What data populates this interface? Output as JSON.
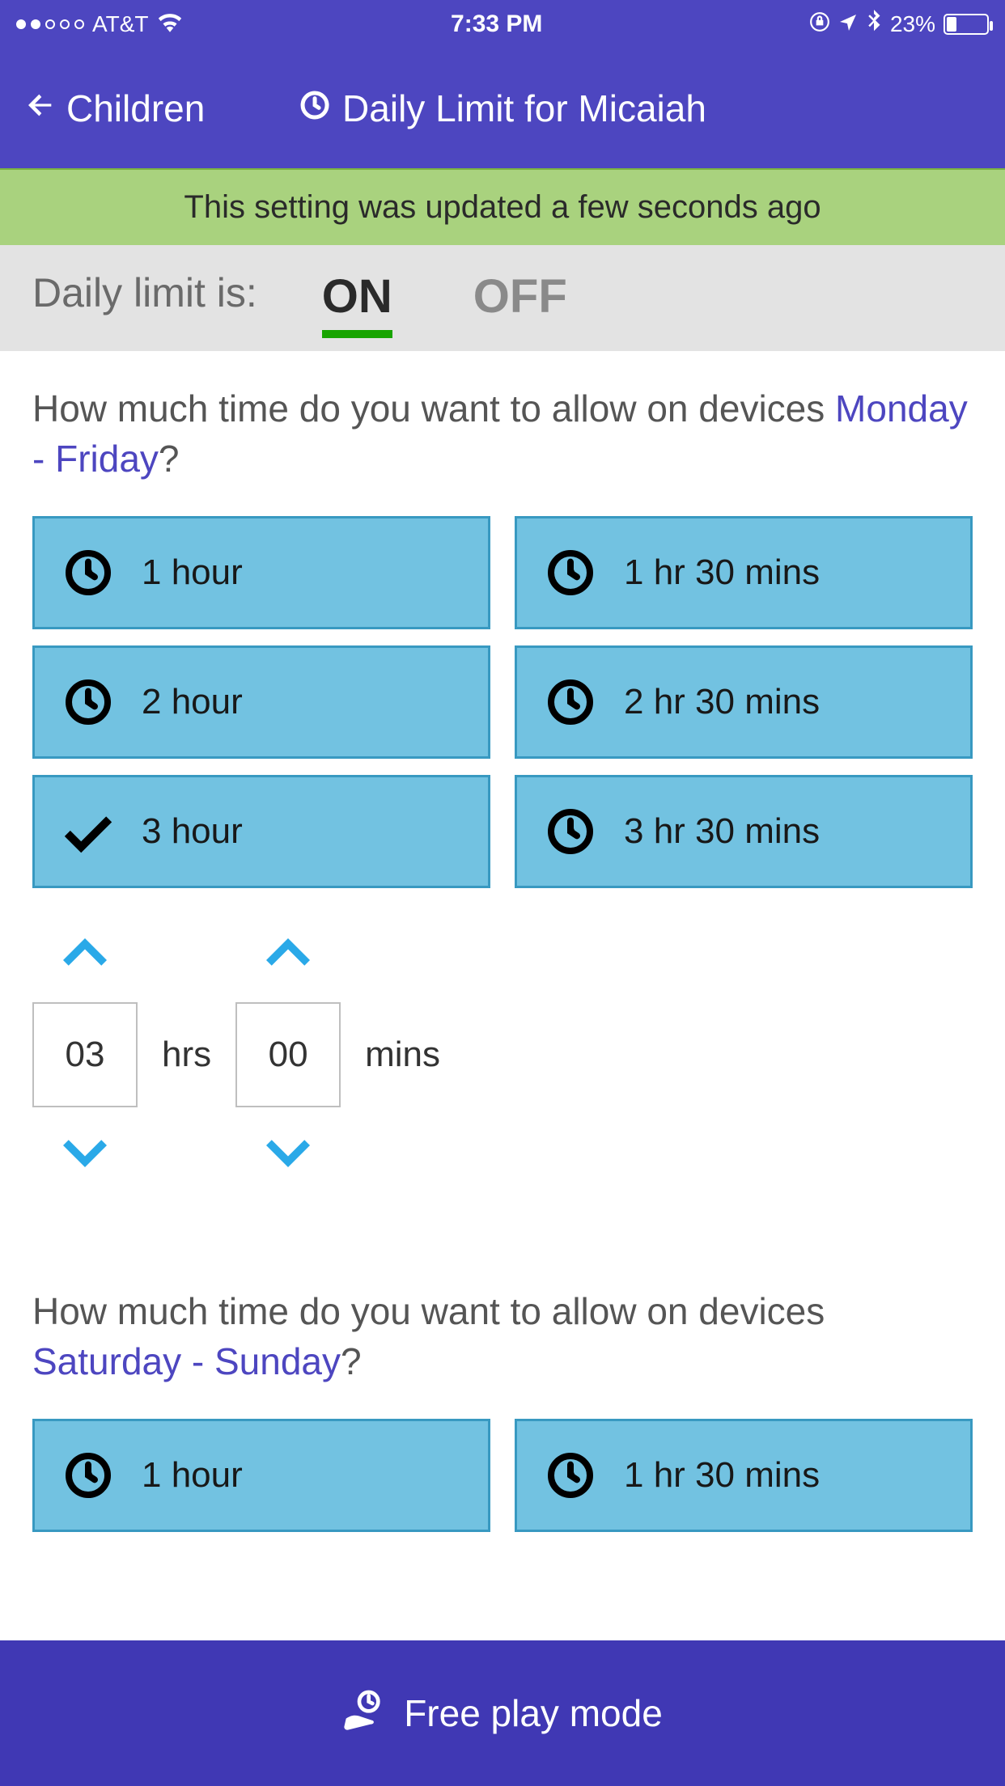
{
  "status": {
    "carrier": "AT&T",
    "time": "7:33 PM",
    "battery_pct": "23%"
  },
  "nav": {
    "back_label": "Children",
    "title": "Daily Limit for Micaiah"
  },
  "banner": {
    "text": "This setting was updated a few seconds ago"
  },
  "toggle": {
    "label": "Daily limit is:",
    "on_label": "ON",
    "off_label": "OFF",
    "active": "on"
  },
  "weekday": {
    "question_prefix": "How much time do you want to allow on devices ",
    "range": "Monday - Friday",
    "question_suffix": "?",
    "options": [
      {
        "label": "1 hour",
        "selected": false
      },
      {
        "label": "1 hr 30 mins",
        "selected": false
      },
      {
        "label": "2 hour",
        "selected": false
      },
      {
        "label": "2 hr 30 mins",
        "selected": false
      },
      {
        "label": "3 hour",
        "selected": true
      },
      {
        "label": "3 hr 30 mins",
        "selected": false
      }
    ],
    "custom": {
      "hours": "03",
      "hours_label": "hrs",
      "minutes": "00",
      "minutes_label": "mins"
    }
  },
  "weekend": {
    "question_prefix": "How much time do you want to allow on devices ",
    "range": "Saturday - Sunday",
    "question_suffix": "?",
    "options": [
      {
        "label": "1 hour",
        "selected": false
      },
      {
        "label": "1 hr 30 mins",
        "selected": false
      }
    ]
  },
  "bottom": {
    "label": "Free play mode"
  }
}
